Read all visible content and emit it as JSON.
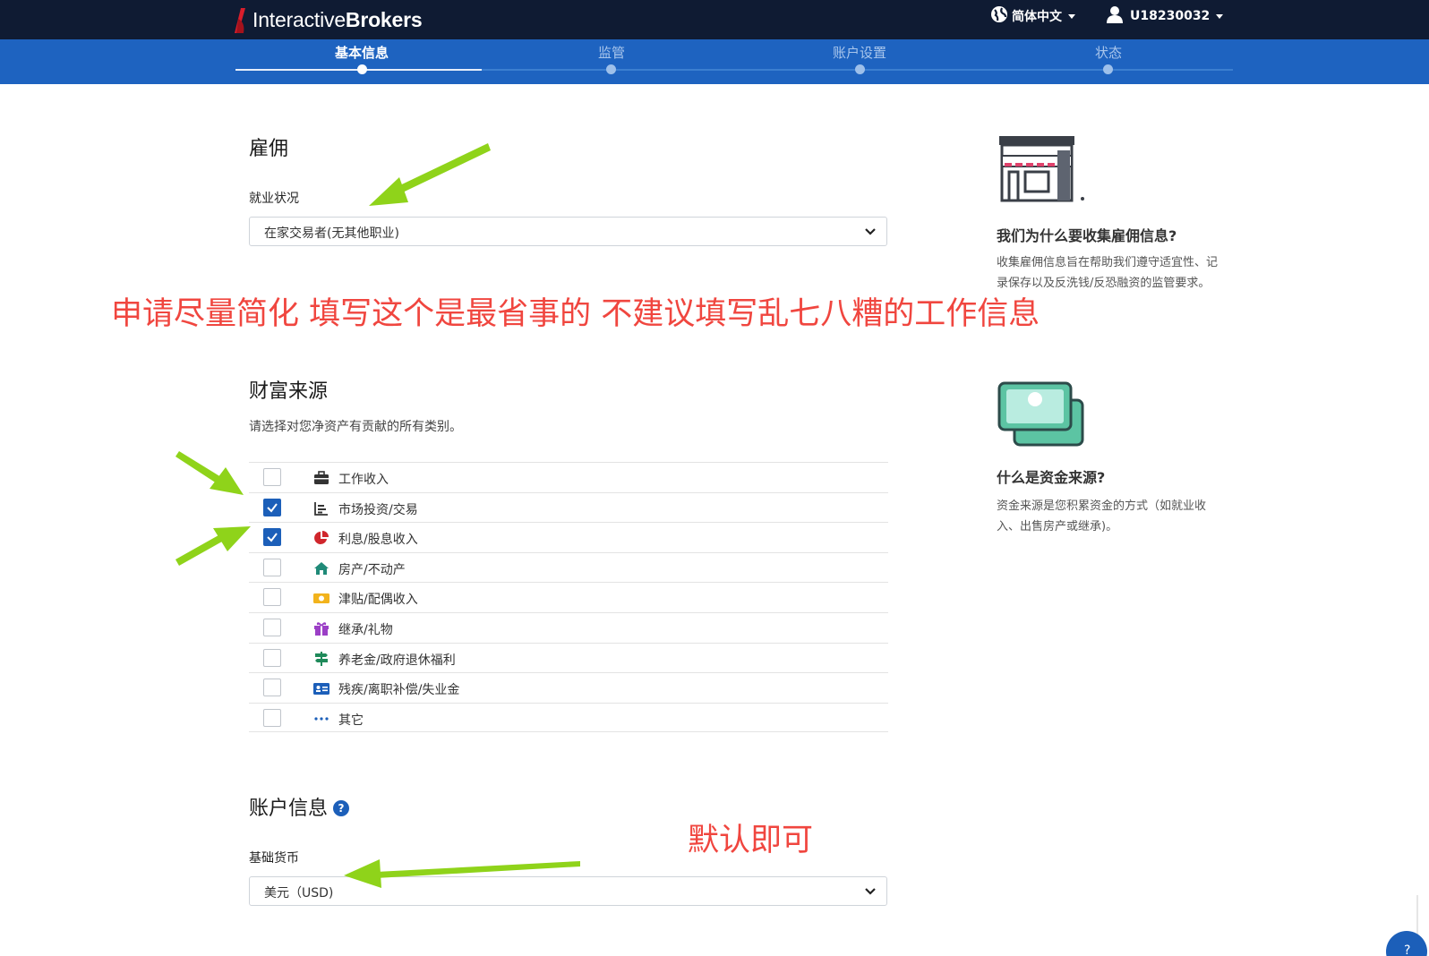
{
  "header": {
    "brand_light": "Interactive",
    "brand_bold": "Brokers",
    "language": "简体中文",
    "user_id": "U18230032"
  },
  "steps": [
    {
      "label": "基本信息",
      "active": true
    },
    {
      "label": "监管",
      "active": false
    },
    {
      "label": "账户设置",
      "active": false
    },
    {
      "label": "状态",
      "active": false
    }
  ],
  "employment": {
    "title": "雇佣",
    "status_label": "就业状况",
    "status_value": "在家交易者(无其他职业)"
  },
  "wealth": {
    "title": "财富来源",
    "subtitle": "请选择对您净资产有贡献的所有类别。",
    "items": [
      {
        "label": "工作收入",
        "icon": "briefcase-icon",
        "checked": false
      },
      {
        "label": "市场投资/交易",
        "icon": "chart-icon",
        "checked": true
      },
      {
        "label": "利息/股息收入",
        "icon": "pie-chart-icon",
        "checked": true
      },
      {
        "label": "房产/不动产",
        "icon": "home-icon",
        "checked": false
      },
      {
        "label": "津贴/配偶收入",
        "icon": "money-icon",
        "checked": false
      },
      {
        "label": "继承/礼物",
        "icon": "gift-icon",
        "checked": false
      },
      {
        "label": "养老金/政府退休福利",
        "icon": "signpost-icon",
        "checked": false
      },
      {
        "label": "残疾/离职补偿/失业金",
        "icon": "id-card-icon",
        "checked": false
      },
      {
        "label": "其它",
        "icon": "more-icon",
        "checked": false
      }
    ]
  },
  "account_info": {
    "title": "账户信息",
    "help": "?",
    "currency_label": "基础货币",
    "currency_value": "美元（USD)"
  },
  "aside": {
    "employment_title": "我们为什么要收集雇佣信息?",
    "employment_text": "收集雇佣信息旨在帮助我们遵守适宜性、记录保存以及反洗钱/反恐融资的监管要求。",
    "wealth_title": "什么是资金来源?",
    "wealth_text": "资金来源是您积累资金的方式（如就业收入、出售房产或继承)。"
  },
  "annotations": {
    "note1": "申请尽量简化 填写这个是最省事的 不建议填写乱七八糟的工作信息",
    "note2": "默认即可"
  },
  "chat": {
    "label": "?"
  },
  "colors": {
    "topbar": "#0f1b33",
    "stepbar": "#1e63c0",
    "checkbox": "#1c5fb9",
    "annotation_red": "#f0463f",
    "annotation_arrow": "#8fd31a"
  }
}
